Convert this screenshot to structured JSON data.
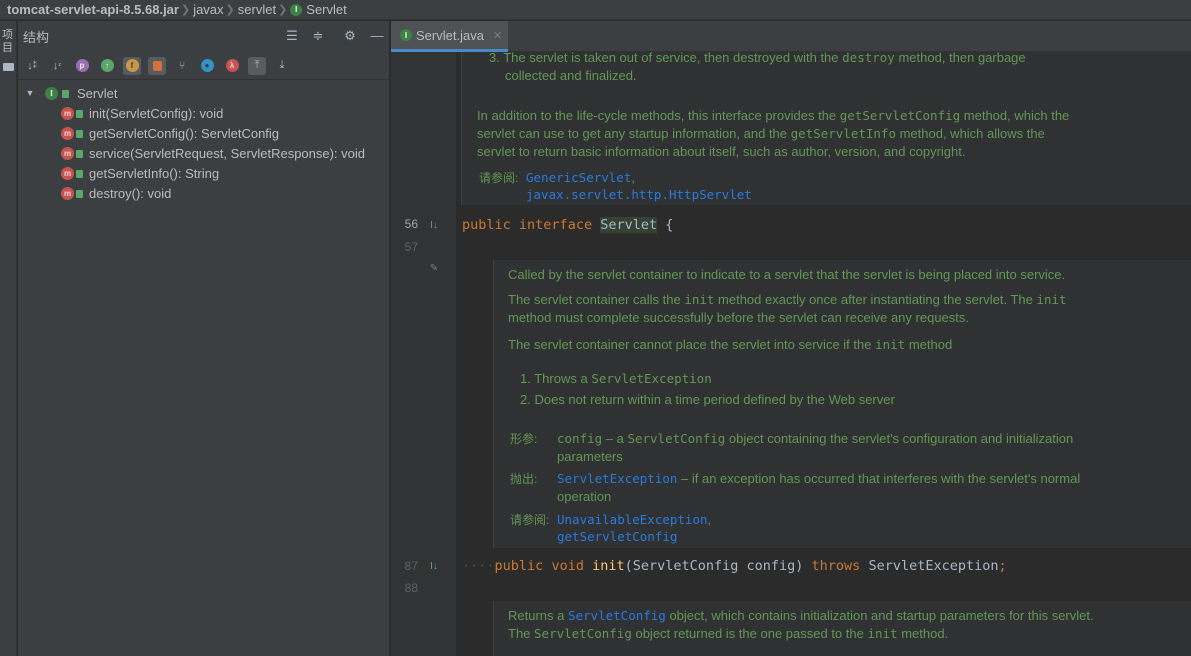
{
  "breadcrumb": {
    "jar": "tomcat-servlet-api-8.5.68.jar",
    "pkg1": "javax",
    "pkg2": "servlet",
    "badge": "I",
    "cls": "Servlet"
  },
  "left_stripe": {
    "label": "项目"
  },
  "structure": {
    "title": "结构",
    "tree": {
      "root": "Servlet",
      "root_badge": "I",
      "items": [
        {
          "label": "init(ServletConfig): void"
        },
        {
          "label": "getServletConfig(): ServletConfig"
        },
        {
          "label": "service(ServletRequest, ServletResponse): void"
        },
        {
          "label": "getServletInfo(): String"
        },
        {
          "label": "destroy(): void"
        }
      ]
    },
    "tool_badges": [
      "p",
      "f",
      "λ"
    ]
  },
  "editor": {
    "tab": {
      "label": "Servlet.java",
      "badge": "I"
    },
    "lines": {
      "l56": "56",
      "l57": "57",
      "l87": "87",
      "l88": "88"
    },
    "doc1": {
      "item3_num": "3.",
      "item3_a": "The servlet is taken out of service, then destroyed with the ",
      "item3_code": "destroy",
      "item3_b": " method, then garbage",
      "item3_c": "collected and finalized.",
      "p_a": "In addition to the life-cycle methods, this interface provides the ",
      "p_code1": "getServletConfig",
      "p_b": " method, which the",
      "p_c": "servlet can use to get any startup information, and the ",
      "p_code2": "getServletInfo",
      "p_d": " method, which allows the",
      "p_e": "servlet to return basic information about itself, such as author, version, and copyright.",
      "see_label": "请参阅:",
      "see1": "GenericServlet",
      "see1_comma": ",",
      "see2": "javax.servlet.http.HttpServlet"
    },
    "code56": {
      "kw1": "public",
      "kw2": "interface",
      "name": "Servlet",
      "brace": " {"
    },
    "doc2": {
      "p1": "Called by the servlet container to indicate to a servlet that the servlet is being placed into service.",
      "p2_a": "The servlet container calls the ",
      "p2_code": "init",
      "p2_b": " method exactly once after instantiating the servlet. The ",
      "p2_code2": "init",
      "p2_c": "method must complete successfully before the servlet can receive any requests.",
      "p3_a": "The servlet container cannot place the servlet into service if the ",
      "p3_code": "init",
      "p3_b": " method",
      "li1_num": "1.",
      "li1_a": "Throws a ",
      "li1_code": "ServletException",
      "li2_num": "2.",
      "li2": "Does not return within a time period defined by the Web server",
      "param_label": "形参:",
      "param_code": "config",
      "param_a": " – a ",
      "param_code2": "ServletConfig",
      "param_b": " object containing the servlet's configuration and initialization",
      "param_c": "parameters",
      "throws_label": "抛出:",
      "throws_code": "ServletException",
      "throws_a": " – if an exception has occurred that interferes with the servlet's normal",
      "throws_b": "operation",
      "see_label": "请参阅:",
      "see1": "UnavailableException",
      "see1_comma": ",",
      "see2": "getServletConfig"
    },
    "code87": {
      "kw1": "public",
      "kw2": "void",
      "fn": "init",
      "args": "(ServletConfig config) ",
      "kw3": "throws",
      "exc": " ServletException",
      "end": ";"
    },
    "doc3": {
      "p1_a": "Returns a ",
      "p1_code": "ServletConfig",
      "p1_b": " object, which contains initialization and startup parameters for this servlet.",
      "p2_a": "The ",
      "p2_code": "ServletConfig",
      "p2_b": " object returned is the one passed to the ",
      "p2_code2": "init",
      "p2_c": " method."
    }
  }
}
